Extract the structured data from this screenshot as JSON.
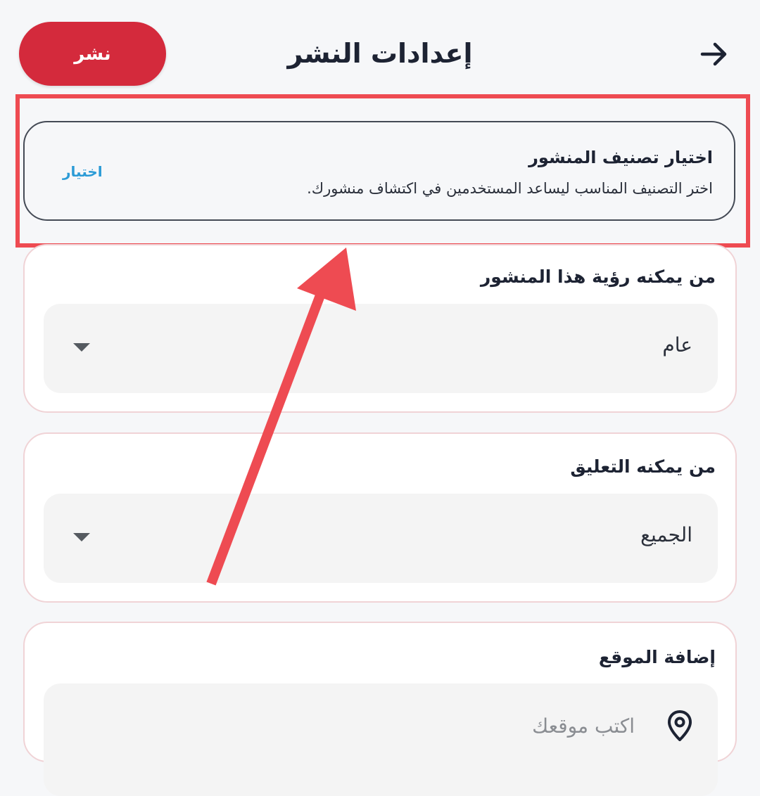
{
  "header": {
    "title": "إعدادات النشر",
    "publish_label": "نشر",
    "back_icon": "arrow-right-icon"
  },
  "category": {
    "title": "اختيار تصنيف المنشور",
    "description": "اختر التصنيف المناسب ليساعد المستخدمين في اكتشاف منشورك.",
    "choose_label": "اختيار"
  },
  "visibility": {
    "label": "من يمكنه رؤية هذا المنشور",
    "selected": "عام"
  },
  "comments": {
    "label": "من يمكنه التعليق",
    "selected": "الجميع"
  },
  "location": {
    "label": "إضافة الموقع",
    "placeholder": "اكتب موقعك",
    "icon": "location-pin-icon"
  },
  "colors": {
    "accent": "#d42a3c",
    "link": "#2b9bd6",
    "annotation": "#ee4b52"
  }
}
